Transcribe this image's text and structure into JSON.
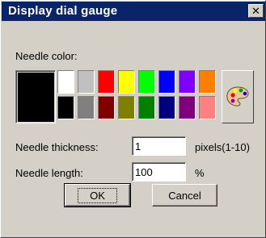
{
  "window": {
    "title": "Display dial gauge",
    "close_glyph": "✕"
  },
  "needle_color": {
    "label": "Needle color:",
    "current": "#000000",
    "swatches_top": [
      "#ffffff",
      "#c0c0c0",
      "#ff0000",
      "#ffff00",
      "#00ff00",
      "#0000ff",
      "#8000ff",
      "#ff8000"
    ],
    "swatches_bottom": [
      "#000000",
      "#808080",
      "#800000",
      "#808000",
      "#008000",
      "#000080",
      "#800080",
      "#ff8080"
    ],
    "palette_button_icon": "palette-icon"
  },
  "thickness": {
    "label": "Needle thickness:",
    "value": "1",
    "unit": "pixels(1-10)"
  },
  "length": {
    "label": "Needle length:",
    "value": "100",
    "unit": "%"
  },
  "buttons": {
    "ok": "OK",
    "cancel": "Cancel"
  }
}
